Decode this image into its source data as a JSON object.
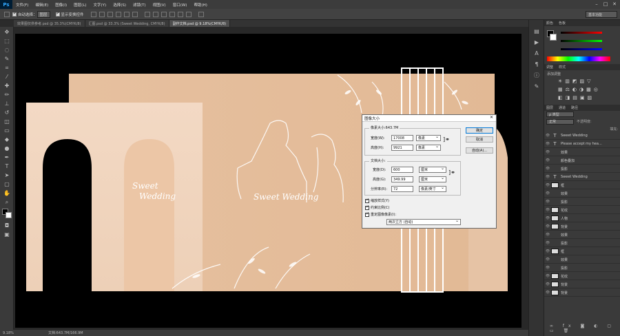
{
  "menubar": {
    "logo": "Ps",
    "items": [
      "文件(F)",
      "编辑(E)",
      "图像(I)",
      "图层(L)",
      "文字(Y)",
      "选择(S)",
      "滤镜(T)",
      "视图(V)",
      "窗口(W)",
      "帮助(H)"
    ],
    "workspace": "基本功能"
  },
  "options": {
    "auto_select_label": "自动选择：",
    "auto_select_value": "图层",
    "transform_label": "显示变换控件"
  },
  "tabs": [
    "效果图仅供参考.psd @ 35.3%(CMYK/8)",
    "汇图.psd @ 33.3% (Sweet  Wedding, CMYK/8)",
    "副作文档.psd @ 9.18%(CMYK/8)"
  ],
  "canvas": {
    "text_left": "Sweet\nWedding",
    "text_center": "Sweet Wedding"
  },
  "status": {
    "zoom": "9.18%",
    "doc": "文档:643.7M/166.9M"
  },
  "panels": {
    "color_tabs": [
      "颜色",
      "色板"
    ],
    "adjust_tabs": [
      "调整",
      "样式"
    ],
    "adjust_title": "添加调整",
    "layer_tabs": [
      "图层",
      "通道",
      "路径"
    ],
    "blend": "正常",
    "opacity": "不透明度:",
    "fill": "填充:"
  },
  "layers": [
    {
      "type": "T",
      "name": "Sweet  Wedding"
    },
    {
      "type": "T",
      "name": "Please accept my hea..."
    },
    {
      "type": "fx",
      "name": "效果"
    },
    {
      "type": "fx",
      "name": "颜色叠加"
    },
    {
      "type": "fx",
      "name": "投影"
    },
    {
      "type": "T",
      "name": "Sweet      Wedding"
    },
    {
      "type": "img",
      "name": "框"
    },
    {
      "type": "fx",
      "name": "效果"
    },
    {
      "type": "fx",
      "name": "投影"
    },
    {
      "type": "img",
      "name": "花纹"
    },
    {
      "type": "img",
      "name": "人物"
    },
    {
      "type": "img",
      "name": "背景"
    },
    {
      "type": "fx",
      "name": "效果"
    },
    {
      "type": "fx",
      "name": "投影"
    },
    {
      "type": "img",
      "name": "框"
    },
    {
      "type": "fx",
      "name": "效果"
    },
    {
      "type": "fx",
      "name": "投影"
    },
    {
      "type": "img",
      "name": "花纹"
    },
    {
      "type": "img",
      "name": "背景"
    },
    {
      "type": "img",
      "name": "背景"
    }
  ],
  "dialog": {
    "title": "图像大小",
    "pixel_size": "像素大小:643.7M",
    "width_label": "宽度(W):",
    "width_value": "17008",
    "width_unit": "像素",
    "height_label": "高度(H):",
    "height_value": "9921",
    "height_unit": "像素",
    "doc_size": "文档大小:",
    "dwidth_label": "宽度(D):",
    "dwidth_value": "600",
    "dwidth_unit": "厘米",
    "dheight_label": "高度(G):",
    "dheight_value": "349.99",
    "dheight_unit": "厘米",
    "res_label": "分辨率(R):",
    "res_value": "72",
    "res_unit": "像素/英寸",
    "scale_styles": "缩放样式(Y)",
    "constrain": "约束比例(C)",
    "resample": "重定图像像素(I):",
    "resample_value": "两次立方 (自动)",
    "ok": "确定",
    "cancel": "取消",
    "auto": "自动(A)..."
  }
}
